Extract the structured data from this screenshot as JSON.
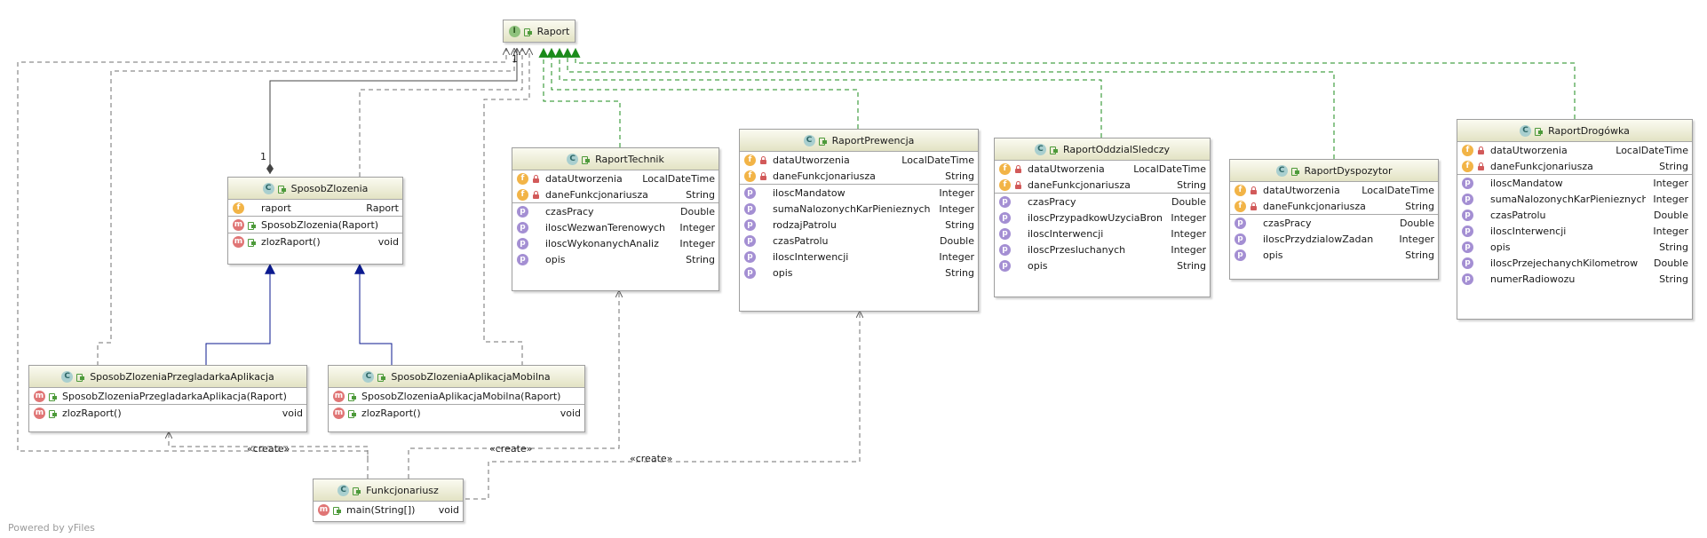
{
  "labels": {
    "create": "«create»",
    "one": "1"
  },
  "watermark": "Powered by yFiles",
  "nodes": {
    "raport": {
      "badge": "I",
      "name": "Raport"
    },
    "sposob": {
      "badge": "C",
      "name": "SposobZlozenia",
      "fields": [
        {
          "icon": "f",
          "name": "raport",
          "type": "Raport"
        }
      ],
      "ctors": [
        {
          "icon": "m",
          "name": "SposobZlozenia(Raport)",
          "type": ""
        }
      ],
      "methods": [
        {
          "icon": "m",
          "name": "zlozRaport()",
          "type": "void"
        }
      ]
    },
    "przegladarka": {
      "badge": "C",
      "name": "SposobZlozeniaPrzegladarkaAplikacja",
      "ctors": [
        {
          "icon": "m",
          "name": "SposobZlozeniaPrzegladarkaAplikacja(Raport)",
          "type": ""
        }
      ],
      "methods": [
        {
          "icon": "m",
          "name": "zlozRaport()",
          "type": "void"
        }
      ]
    },
    "mobilna": {
      "badge": "C",
      "name": "SposobZlozeniaAplikacjaMobilna",
      "ctors": [
        {
          "icon": "m",
          "name": "SposobZlozeniaAplikacjaMobilna(Raport)",
          "type": ""
        }
      ],
      "methods": [
        {
          "icon": "m",
          "name": "zlozRaport()",
          "type": "void"
        }
      ]
    },
    "funkcjonariusz": {
      "badge": "C",
      "name": "Funkcjonariusz",
      "methods": [
        {
          "icon": "m",
          "name": "main(String[])",
          "type": "void"
        }
      ]
    },
    "technik": {
      "badge": "C",
      "name": "RaportTechnik",
      "fields": [
        {
          "icon": "f",
          "name": "dataUtworzenia",
          "type": "LocalDateTime"
        },
        {
          "icon": "f",
          "name": "daneFunkcjonariusza",
          "type": "String"
        }
      ],
      "props": [
        {
          "icon": "p",
          "name": "czasPracy",
          "type": "Double"
        },
        {
          "icon": "p",
          "name": "iloscWezwanTerenowych",
          "type": "Integer"
        },
        {
          "icon": "p",
          "name": "iloscWykonanychAnaliz",
          "type": "Integer"
        },
        {
          "icon": "p",
          "name": "opis",
          "type": "String"
        }
      ]
    },
    "prewencja": {
      "badge": "C",
      "name": "RaportPrewencja",
      "fields": [
        {
          "icon": "f",
          "name": "dataUtworzenia",
          "type": "LocalDateTime"
        },
        {
          "icon": "f",
          "name": "daneFunkcjonariusza",
          "type": "String"
        }
      ],
      "props": [
        {
          "icon": "p",
          "name": "iloscMandatow",
          "type": "Integer"
        },
        {
          "icon": "p",
          "name": "sumaNalozonychKarPienieznych",
          "type": "Integer"
        },
        {
          "icon": "p",
          "name": "rodzajPatrolu",
          "type": "String"
        },
        {
          "icon": "p",
          "name": "czasPatrolu",
          "type": "Double"
        },
        {
          "icon": "p",
          "name": "iloscInterwencji",
          "type": "Integer"
        },
        {
          "icon": "p",
          "name": "opis",
          "type": "String"
        }
      ]
    },
    "oddzial": {
      "badge": "C",
      "name": "RaportOddzialSledczy",
      "fields": [
        {
          "icon": "f",
          "name": "dataUtworzenia",
          "type": "LocalDateTime"
        },
        {
          "icon": "f",
          "name": "daneFunkcjonariusza",
          "type": "String"
        }
      ],
      "props": [
        {
          "icon": "p",
          "name": "czasPracy",
          "type": "Double"
        },
        {
          "icon": "p",
          "name": "iloscPrzypadkowUzyciaBroni",
          "type": "Integer"
        },
        {
          "icon": "p",
          "name": "iloscInterwencji",
          "type": "Integer"
        },
        {
          "icon": "p",
          "name": "iloscPrzesluchanych",
          "type": "Integer"
        },
        {
          "icon": "p",
          "name": "opis",
          "type": "String"
        }
      ]
    },
    "dyspozytor": {
      "badge": "C",
      "name": "RaportDyspozytor",
      "fields": [
        {
          "icon": "f",
          "name": "dataUtworzenia",
          "type": "LocalDateTime"
        },
        {
          "icon": "f",
          "name": "daneFunkcjonariusza",
          "type": "String"
        }
      ],
      "props": [
        {
          "icon": "p",
          "name": "czasPracy",
          "type": "Double"
        },
        {
          "icon": "p",
          "name": "iloscPrzydzialowZadan",
          "type": "Integer"
        },
        {
          "icon": "p",
          "name": "opis",
          "type": "String"
        }
      ]
    },
    "drogowka": {
      "badge": "C",
      "name": "RaportDrogówka",
      "fields": [
        {
          "icon": "f",
          "name": "dataUtworzenia",
          "type": "LocalDateTime"
        },
        {
          "icon": "f",
          "name": "daneFunkcjonariusza",
          "type": "String"
        }
      ],
      "props": [
        {
          "icon": "p",
          "name": "iloscMandatow",
          "type": "Integer"
        },
        {
          "icon": "p",
          "name": "sumaNalozonychKarPienieznych",
          "type": "Integer"
        },
        {
          "icon": "p",
          "name": "czasPatrolu",
          "type": "Double"
        },
        {
          "icon": "p",
          "name": "iloscInterwencji",
          "type": "Integer"
        },
        {
          "icon": "p",
          "name": "opis",
          "type": "String"
        },
        {
          "icon": "p",
          "name": "iloscPrzejechanychKilometrow",
          "type": "Double"
        },
        {
          "icon": "p",
          "name": "numerRadiowozu",
          "type": "String"
        }
      ]
    }
  }
}
